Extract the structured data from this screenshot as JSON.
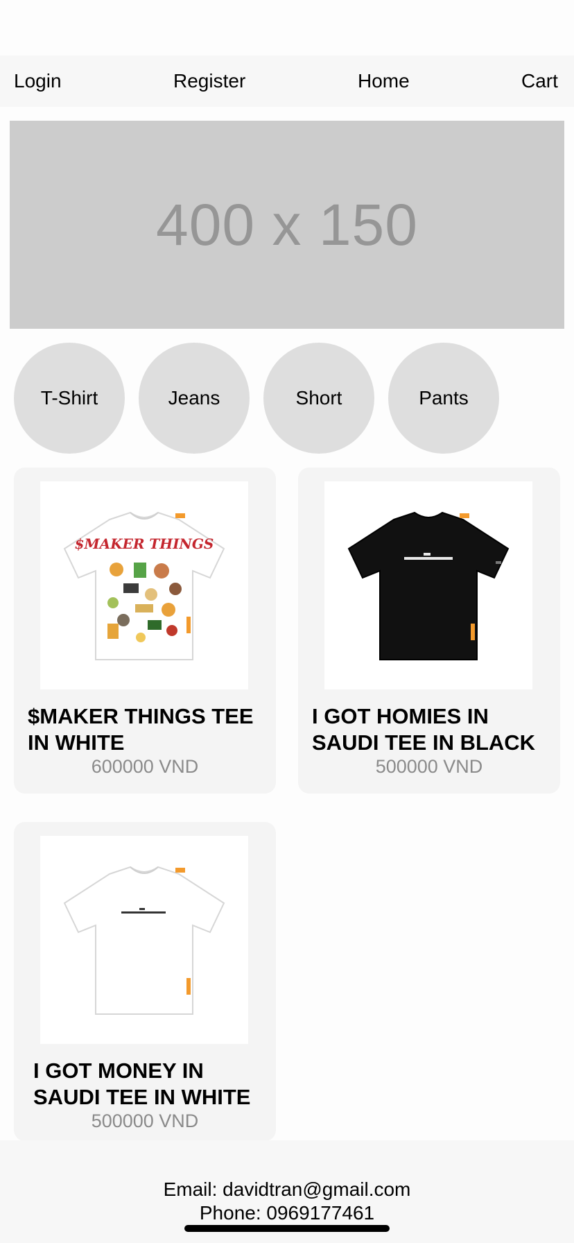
{
  "nav": {
    "login": "Login",
    "register": "Register",
    "home": "Home",
    "cart": "Cart"
  },
  "banner": {
    "placeholder_text": "400 x 150"
  },
  "categories": [
    {
      "label": "T-Shirt"
    },
    {
      "label": "Jeans"
    },
    {
      "label": "Short"
    },
    {
      "label": "Pants"
    }
  ],
  "products": [
    {
      "title": "$MAKER THINGS TEE IN WHITE",
      "price": "600000 VND",
      "image": "white-tee-graphic-print",
      "shirt_color": "#ffffff"
    },
    {
      "title": "I GOT HOMIES IN SAUDI TEE IN BLACK",
      "price": "500000 VND",
      "image": "black-tee-small-print",
      "shirt_color": "#111111"
    },
    {
      "title": "I GOT MONEY IN SAUDI TEE IN WHITE",
      "price": "500000 VND",
      "image": "white-tee-small-print",
      "shirt_color": "#ffffff"
    }
  ],
  "footer": {
    "email": "Email: davidtran@gmail.com",
    "phone": "Phone: 0969177461"
  }
}
